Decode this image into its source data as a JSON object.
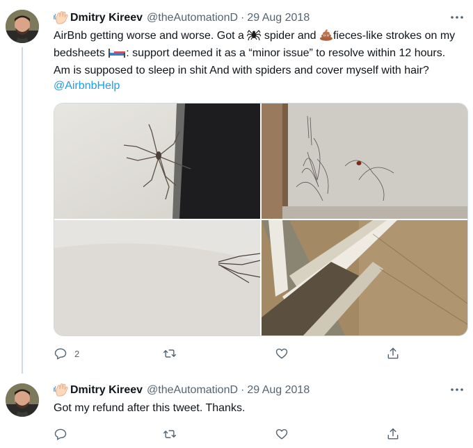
{
  "tweets": [
    {
      "name": "Dmitry Kireev",
      "handle": "@theAutomationD",
      "separator": "·",
      "date": "29 Aug 2018",
      "text_parts": {
        "p1": "AirBnb getting worse and worse. Got a ",
        "p2": " spider and ",
        "p3": "fieces-like strokes on my bedsheets ",
        "p4": ": support deemed it as a “minor issue” to resolve within 12 hours. Am is supposed to sleep in shit And with spiders and cover myself with hair? ",
        "mention": "@AirbnbHelp"
      },
      "media_count": 4,
      "actions": {
        "reply_count": "2",
        "retweet_count": "",
        "like_count": ""
      }
    },
    {
      "name": "Dmitry Kireev",
      "handle": "@theAutomationD",
      "separator": "·",
      "date": "29 Aug 2018",
      "text": "Got my refund after this tweet. Thanks.",
      "actions": {
        "reply_count": "",
        "retweet_count": "",
        "like_count": ""
      }
    }
  ],
  "icons": {
    "avatar": "profile-photo-man-with-beard",
    "name_emoji": "waving-hand-emoji",
    "spider": "spider-emoji",
    "poop": "pile-of-poo-emoji",
    "bed": "bed-emoji",
    "more": "more-dots-icon",
    "reply": "reply-icon",
    "retweet": "retweet-icon",
    "like": "heart-icon",
    "share": "share-icon"
  },
  "colors": {
    "accent": "#1d9bf0",
    "secondary_text": "#536471",
    "thread_line": "#cfd9de"
  }
}
